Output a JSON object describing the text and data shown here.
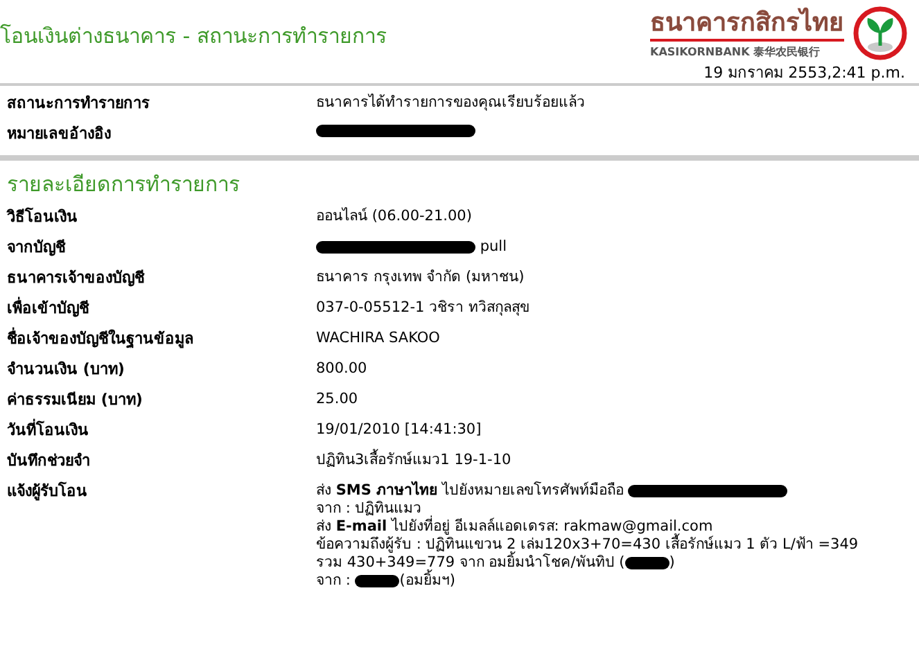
{
  "page_title": "โอนเงินต่างธนาคาร - สถานะการทำรายการ",
  "logo": {
    "name_thai": "ธนาคารกสิกรไทย",
    "name_latin": "KASIKORNBANK",
    "name_chinese": "泰华农民银行"
  },
  "timestamp": "19 มกราคม 2553,2:41 p.m.",
  "status_rows": [
    {
      "label": "สถานะการทำรายการ",
      "lines": [
        [
          {
            "kind": "text",
            "text": "ธนาคารได้ทำรายการของคุณเรียบร้อยแล้ว"
          }
        ]
      ]
    },
    {
      "label": "หมายเลขอ้างอิง",
      "lines": [
        [
          {
            "kind": "blackout"
          }
        ]
      ]
    }
  ],
  "section_title": "รายละเอียดการทำรายการ",
  "detail_rows": [
    {
      "label": "วิธีโอนเงิน",
      "lines": [
        [
          {
            "kind": "text",
            "text": "ออนไลน์ (06.00-21.00)"
          }
        ]
      ]
    },
    {
      "label": "จากบัญชี",
      "lines": [
        [
          {
            "kind": "blackout"
          },
          {
            "kind": "text",
            "text": " pull"
          }
        ]
      ]
    },
    {
      "label": "ธนาคารเจ้าของบัญชี",
      "lines": [
        [
          {
            "kind": "text",
            "text": "ธนาคาร กรุงเทพ จำกัด (มหาชน)"
          }
        ]
      ]
    },
    {
      "label": "เพื่อเข้าบัญชี",
      "lines": [
        [
          {
            "kind": "text",
            "text": "037-0-05512-1 วชิรา ทวิสกุลสุข"
          }
        ]
      ]
    },
    {
      "label": "ชื่อเจ้าของบัญชีในฐานข้อมูล",
      "lines": [
        [
          {
            "kind": "text",
            "text": "WACHIRA SAKOO"
          }
        ]
      ]
    },
    {
      "label": "จำนวนเงิน (บาท)",
      "lines": [
        [
          {
            "kind": "text",
            "text": "800.00"
          }
        ]
      ]
    },
    {
      "label": "ค่าธรรมเนียม (บาท)",
      "lines": [
        [
          {
            "kind": "text",
            "text": "25.00"
          }
        ]
      ]
    },
    {
      "label": "วันที่โอนเงิน",
      "lines": [
        [
          {
            "kind": "text",
            "text": "19/01/2010 [14:41:30]"
          }
        ]
      ]
    },
    {
      "label": "บันทึกช่วยจำ",
      "lines": [
        [
          {
            "kind": "text",
            "text": "ปฏิทิน3เสื้อรักษ์แมว1 19-1-10"
          }
        ]
      ]
    },
    {
      "label": "แจ้งผู้รับโอน",
      "lines": [
        [
          {
            "kind": "text",
            "text": "ส่ง **SMS ภาษาไทย** ไปยังหมายเลขโทรศัพท์มือถือ "
          },
          {
            "kind": "blackout"
          }
        ],
        [
          {
            "kind": "text",
            "text": "จาก : ปฏิทินแมว"
          }
        ],
        [
          {
            "kind": "text",
            "text": "ส่ง **E-mail** ไปยังที่อยู่ อีเมลล์แอดเดรส: rakmaw@gmail.com"
          }
        ],
        [
          {
            "kind": "text",
            "text": "ข้อความถึงผู้รับ : ปฏิทินแขวน 2 เล่ม120x3+70=430 เสื้อรักษ์แมว 1 ตัว L/ฟ้า =349"
          }
        ],
        [
          {
            "kind": "text",
            "text": "รวม 430+349=779 จาก อมยิ้มนำโชค/พันทิป ("
          },
          {
            "kind": "blot"
          },
          {
            "kind": "text",
            "text": ")"
          }
        ],
        [
          {
            "kind": "text",
            "text": "จาก : "
          },
          {
            "kind": "blot"
          },
          {
            "kind": "text",
            "text": "(อมยิ้มฯ)"
          }
        ]
      ]
    }
  ]
}
